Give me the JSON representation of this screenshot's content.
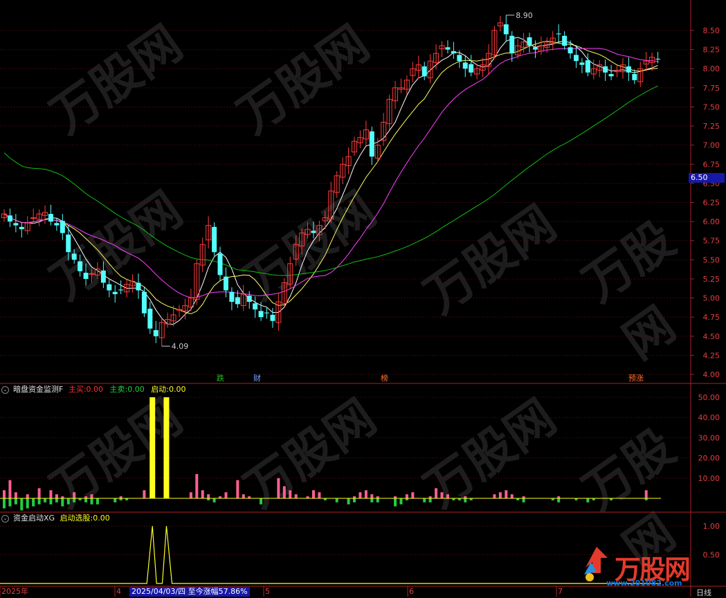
{
  "price_axis": {
    "labels": [
      "8.50",
      "8.25",
      "8.00",
      "7.75",
      "7.50",
      "7.25",
      "7.00",
      "6.75",
      "6.50",
      "6.25",
      "6.00",
      "5.75",
      "5.50",
      "5.25",
      "5.00",
      "4.75",
      "4.50",
      "4.25",
      "4.00"
    ],
    "current_price": "6.50",
    "high_label": "8.90",
    "low_label": "4.09"
  },
  "event_badges": [
    {
      "label": "跌",
      "color": "#20c020"
    },
    {
      "label": "财",
      "color": "#6fa8ff"
    },
    {
      "label": "榜",
      "color": "#ff7030"
    },
    {
      "label": "预涨",
      "color": "#ff7030"
    }
  ],
  "panel1": {
    "title": "暗盘资金监测F",
    "buy_label": "主买:",
    "buy_value": "0.00",
    "sell_label": "主卖:",
    "sell_value": "0.00",
    "start_label": "启动:",
    "start_value": "0.00",
    "axis_labels": [
      "50.00",
      "40.00",
      "30.00",
      "20.00",
      "10.00"
    ]
  },
  "panel2": {
    "title": "资金启动XG",
    "select_label": "启动选股:",
    "select_value": "0.00",
    "axis_labels": [
      "1.00",
      "0.50"
    ]
  },
  "time_axis": {
    "labels": [
      "2025年",
      "4",
      "5",
      "6",
      "7"
    ],
    "info": "2025/04/03/四  至今涨幅57.86%",
    "period": "日线"
  },
  "watermark": {
    "brand": "万股网",
    "site": "www.201082.com"
  },
  "colors": {
    "up": "#ff3b3b",
    "down": "#54ffff",
    "ma5": "#ffffff",
    "ma10": "#ffff60",
    "ma20": "#ff40ff",
    "ma60": "#10c010",
    "buy_bar": "#ff6090",
    "sell_bar": "#20d040",
    "signal": "#ffff20"
  }
}
